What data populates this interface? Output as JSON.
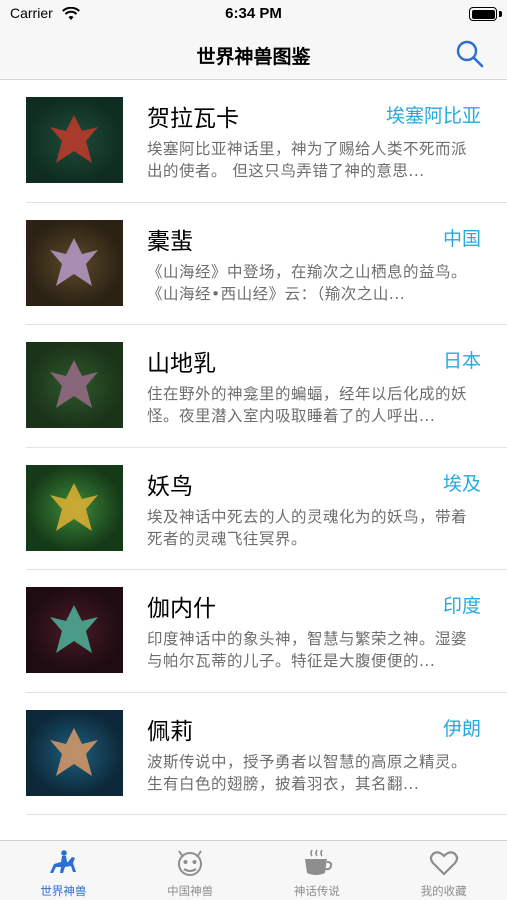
{
  "status_bar": {
    "carrier": "Carrier",
    "time": "6:34 PM"
  },
  "nav": {
    "title": "世界神兽图鉴",
    "search_icon": "search-icon"
  },
  "items": [
    {
      "name": "贺拉瓦卡",
      "region": "埃塞阿比亚",
      "desc": "埃塞阿比亚神话里，神为了赐给人类不死而派出的使者。 但这只鸟弄错了神的意思...",
      "colors": [
        "#1f4d3a",
        "#0f2d20",
        "#c23a2a"
      ]
    },
    {
      "name": "橐蜚",
      "region": "中国",
      "desc": "《山海经》中登场，在羭次之山栖息的益鸟。《山海经•西山经》云：（羭次之山...",
      "colors": [
        "#5b4a2a",
        "#2c2214",
        "#b79bc9"
      ]
    },
    {
      "name": "山地乳",
      "region": "日本",
      "desc": "住在野外的神龛里的蝙蝠，经年以后化成的妖怪。夜里潜入室内吸取睡着了的人呼出...",
      "colors": [
        "#2e5a2c",
        "#1b3319",
        "#9a6a88"
      ]
    },
    {
      "name": "妖鸟",
      "region": "埃及",
      "desc": "埃及神话中死去的人的灵魂化为的妖鸟，带着死者的灵魂飞往冥界。",
      "colors": [
        "#3f8a3a",
        "#153a18",
        "#e0b032"
      ]
    },
    {
      "name": "伽内什",
      "region": "印度",
      "desc": "印度神话中的象头神，智慧与繁荣之神。湿婆与帕尔瓦蒂的儿子。特征是大腹便便的...",
      "colors": [
        "#4a1a26",
        "#1e0c12",
        "#4db39b"
      ]
    },
    {
      "name": "佩莉",
      "region": "伊朗",
      "desc": "波斯传说中，授予勇者以智慧的高原之精灵。生有白色的翅膀，披着羽衣，其名翻...",
      "colors": [
        "#1f5f7f",
        "#0d2838",
        "#d99a66"
      ]
    }
  ],
  "tabs": [
    {
      "label": "世界神兽",
      "icon": "horse-rider-icon",
      "active": true
    },
    {
      "label": "中国神兽",
      "icon": "dragon-face-icon",
      "active": false
    },
    {
      "label": "神话传说",
      "icon": "coffee-cup-icon",
      "active": false
    },
    {
      "label": "我的收藏",
      "icon": "heart-icon",
      "active": false
    }
  ],
  "colors": {
    "accent": "#27a9de",
    "tab_active": "#2a6fd4",
    "tab_inactive": "#8e8e8e"
  }
}
